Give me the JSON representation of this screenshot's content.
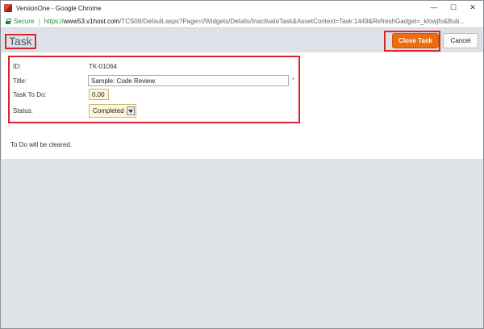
{
  "window": {
    "title": "VersionOne - Google Chrome",
    "minimize_glyph": "—",
    "maximize_glyph": "☐",
    "close_glyph": "✕"
  },
  "address": {
    "secure_label": "Secure",
    "separator": "|",
    "url_scheme": "https://",
    "url_host": "www53.v1host.com",
    "url_rest": "/TCS08/Default.aspx?Page=//Widgets/Details/InactivateTask&AssetContext=Task:1449&RefreshGadget=_klowjfo&Bub..."
  },
  "header": {
    "title": "Task",
    "close_task_label": "Close Task",
    "cancel_label": "Cancel"
  },
  "form": {
    "id_label": "ID:",
    "id_value": "TK-01064",
    "title_label": "Title:",
    "title_value": "Sample: Code Review",
    "required_marker": "*",
    "todo_label": "Task To Do:",
    "todo_value": "0.00",
    "status_label": "Status:",
    "status_value": "Completed"
  },
  "note": "To Do will be cleared.",
  "colors": {
    "accent_orange": "#ec6c10",
    "highlight_red": "#d9262c",
    "secure_green": "#1e8e3e"
  }
}
